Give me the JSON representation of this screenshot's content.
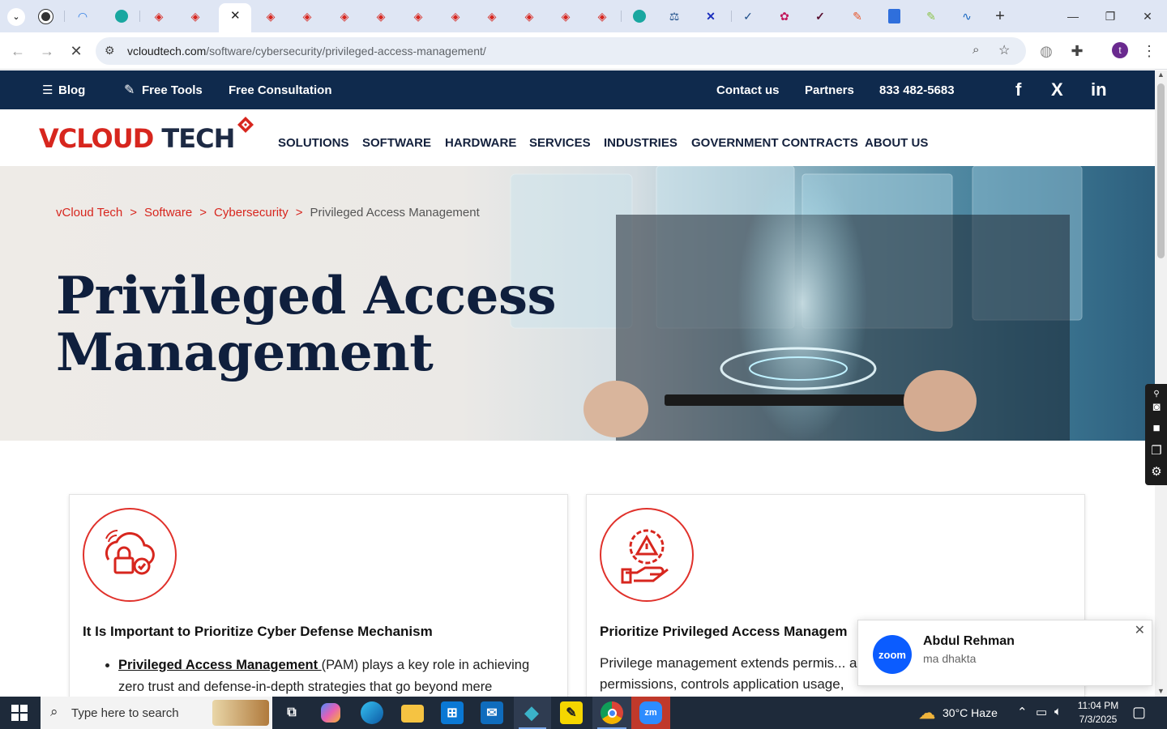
{
  "browser": {
    "url_domain": "vcloudtech.com",
    "url_path": "/software/cybersecurity/privileged-access-management/",
    "tabs": [
      {
        "icon": "new-tab-dropdown-icon",
        "color": "#1f1f1f"
      },
      {
        "icon": "cookie-icon",
        "color": "#333333"
      },
      {
        "icon": "speed-icon",
        "color": "#2c7be5"
      },
      {
        "icon": "teal-app-icon",
        "color": "#19a7a0"
      },
      {
        "icon": "vcloud-icon",
        "color": "#d7261e"
      },
      {
        "icon": "vcloud-icon",
        "color": "#d7261e"
      },
      {
        "icon": "vcloud-icon",
        "color": "#d7261e"
      },
      {
        "icon": "vcloud-icon",
        "color": "#d7261e"
      },
      {
        "icon": "vcloud-icon",
        "color": "#d7261e"
      },
      {
        "icon": "vcloud-icon",
        "color": "#d7261e"
      },
      {
        "icon": "vcloud-icon",
        "color": "#d7261e"
      },
      {
        "icon": "vcloud-icon",
        "color": "#d7261e"
      },
      {
        "icon": "vcloud-icon",
        "color": "#d7261e"
      },
      {
        "icon": "vcloud-icon",
        "color": "#d7261e"
      },
      {
        "icon": "vcloud-icon",
        "color": "#d7261e"
      },
      {
        "icon": "teal-app-icon",
        "color": "#19a7a0"
      },
      {
        "icon": "scales-icon",
        "color": "#1d4e89"
      },
      {
        "icon": "x-tool-icon",
        "color": "#1a2dbd"
      },
      {
        "icon": "check-icon",
        "color": "#1d4e89"
      },
      {
        "icon": "multi-icon",
        "color": "#c2185b"
      },
      {
        "icon": "check-icon",
        "color": "#5a1030"
      },
      {
        "icon": "pen-icon",
        "color": "#e8552a"
      },
      {
        "icon": "docs-icon",
        "color": "#2f6fdc"
      },
      {
        "icon": "pen-icon",
        "color": "#8bc34a"
      },
      {
        "icon": "pulse-icon",
        "color": "#1565c0"
      }
    ],
    "profile_initial": "t"
  },
  "topbar": {
    "blog": "Blog",
    "free_tools": "Free Tools",
    "free_consultation": "Free Consultation",
    "contact": "Contact us",
    "partners": "Partners",
    "phone": "833 482-5683",
    "social_facebook": "f",
    "social_x": "X",
    "social_linkedin": "in"
  },
  "logo": {
    "part_red": "VCLOUD",
    "part_navy": "TECH"
  },
  "nav": {
    "solutions": "SOLUTIONS",
    "software": "SOFTWARE",
    "hardware": "HARDWARE",
    "services": "SERVICES",
    "industries": "INDUSTRIES",
    "government": "GOVERNMENT CONTRACTS",
    "about": "ABOUT US"
  },
  "hero": {
    "breadcrumb": [
      "vCloud Tech",
      "Software",
      "Cybersecurity"
    ],
    "breadcrumb_sep": ">",
    "breadcrumb_current": "Privileged Access Management",
    "title_line1": "Privileged Access",
    "title_line2": "Management"
  },
  "cards": [
    {
      "title": "It Is Important to Prioritize Cyber Defense Mechanism",
      "link_text": "Privileged Access Management ",
      "body_after_link": "(PAM) plays a key role in achieving zero trust and defense-in-depth strategies that go beyond mere"
    },
    {
      "title": "Prioritize Privileged Access Managem",
      "body": "Privilege management extends permis... applications that require permissions, controls application usage,"
    }
  ],
  "notification": {
    "app": "zoom",
    "sender": "Abdul Rehman",
    "message": "ma dhakta"
  },
  "taskbar": {
    "search_placeholder": "Type here to search",
    "weather": "30°C  Haze",
    "time": "11:04 PM",
    "date": "7/3/2025"
  }
}
